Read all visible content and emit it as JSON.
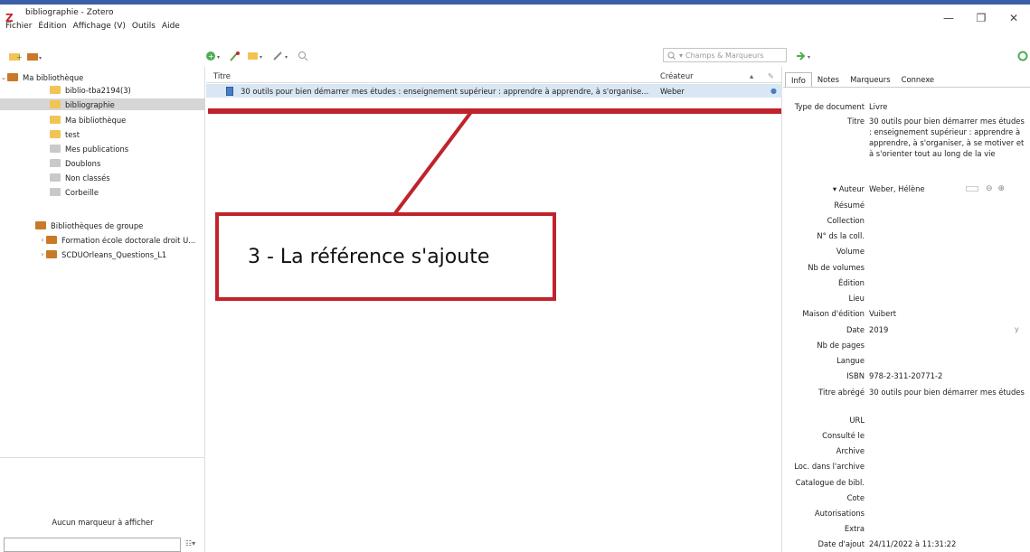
{
  "window": {
    "title": "bibliographie - Zotero",
    "logo_letter": "Z",
    "controls": [
      "—",
      "❐",
      "✕"
    ]
  },
  "menu": {
    "items": [
      "Fichier",
      "Édition",
      "Affichage (V)",
      "Outils",
      "Aide"
    ]
  },
  "search": {
    "placeholder": "Champs & Marqueurs"
  },
  "collections": {
    "items": [
      {
        "label": "Ma bibliothèque"
      },
      {
        "label": "biblio-tba2194(3)"
      },
      {
        "label": "bibliographie"
      },
      {
        "label": "Ma bibliothèque"
      },
      {
        "label": "test"
      },
      {
        "label": "Mes publications"
      },
      {
        "label": "Doublons"
      },
      {
        "label": "Non classés"
      },
      {
        "label": "Corbeille"
      }
    ],
    "group_header": "Bibliothèques de groupe",
    "groups": [
      {
        "label": "Formation école doctorale droit U..."
      },
      {
        "label": "SCDUOrleans_Questions_L1"
      }
    ]
  },
  "tags": {
    "empty_text": "Aucun marqueur à afficher"
  },
  "items": {
    "columns": {
      "title": "Titre",
      "creator": "Créateur"
    },
    "rows": [
      {
        "title": "30 outils pour bien démarrer mes études : enseignement supérieur : apprendre à apprendre, à s'organise...",
        "creator": "Weber"
      }
    ]
  },
  "callout": {
    "text": "3 - La référence s'ajoute"
  },
  "item_pane": {
    "tabs": [
      "Info",
      "Notes",
      "Marqueurs",
      "Connexe"
    ],
    "fields": [
      {
        "label": "Type de document",
        "value": "Livre"
      },
      {
        "label": "Titre",
        "value": "30 outils pour bien démarrer mes études : enseignement supérieur : apprendre à apprendre, à s'organiser, à se motiver et à s'orienter tout au long de la vie"
      },
      {
        "label": "▾ Auteur",
        "value": "Weber, Hélène"
      },
      {
        "label": "Résumé",
        "value": ""
      },
      {
        "label": "Collection",
        "value": ""
      },
      {
        "label": "N° ds la coll.",
        "value": ""
      },
      {
        "label": "Volume",
        "value": ""
      },
      {
        "label": "Nb de volumes",
        "value": ""
      },
      {
        "label": "Édition",
        "value": ""
      },
      {
        "label": "Lieu",
        "value": ""
      },
      {
        "label": "Maison d'édition",
        "value": "Vuibert"
      },
      {
        "label": "Date",
        "value": "2019"
      },
      {
        "label": "Nb de pages",
        "value": ""
      },
      {
        "label": "Langue",
        "value": ""
      },
      {
        "label": "ISBN",
        "value": "978-2-311-20771-2"
      },
      {
        "label": "Titre abrégé",
        "value": "30 outils pour bien démarrer mes études"
      },
      {
        "label": "URL",
        "value": ""
      },
      {
        "label": "Consulté le",
        "value": ""
      },
      {
        "label": "Archive",
        "value": ""
      },
      {
        "label": "Loc. dans l'archive",
        "value": ""
      },
      {
        "label": "Catalogue de bibl.",
        "value": ""
      },
      {
        "label": "Cote",
        "value": ""
      },
      {
        "label": "Autorisations",
        "value": ""
      },
      {
        "label": "Extra",
        "value": ""
      },
      {
        "label": "Date d'ajout",
        "value": "24/11/2022 à 11:31:22"
      }
    ],
    "date_y_marker": "y"
  },
  "colors": {
    "accent_red": "#c0232c",
    "selection_blue": "#d9e6f4",
    "folder_yellow": "#f1c455",
    "folder_brown": "#c87a28"
  }
}
